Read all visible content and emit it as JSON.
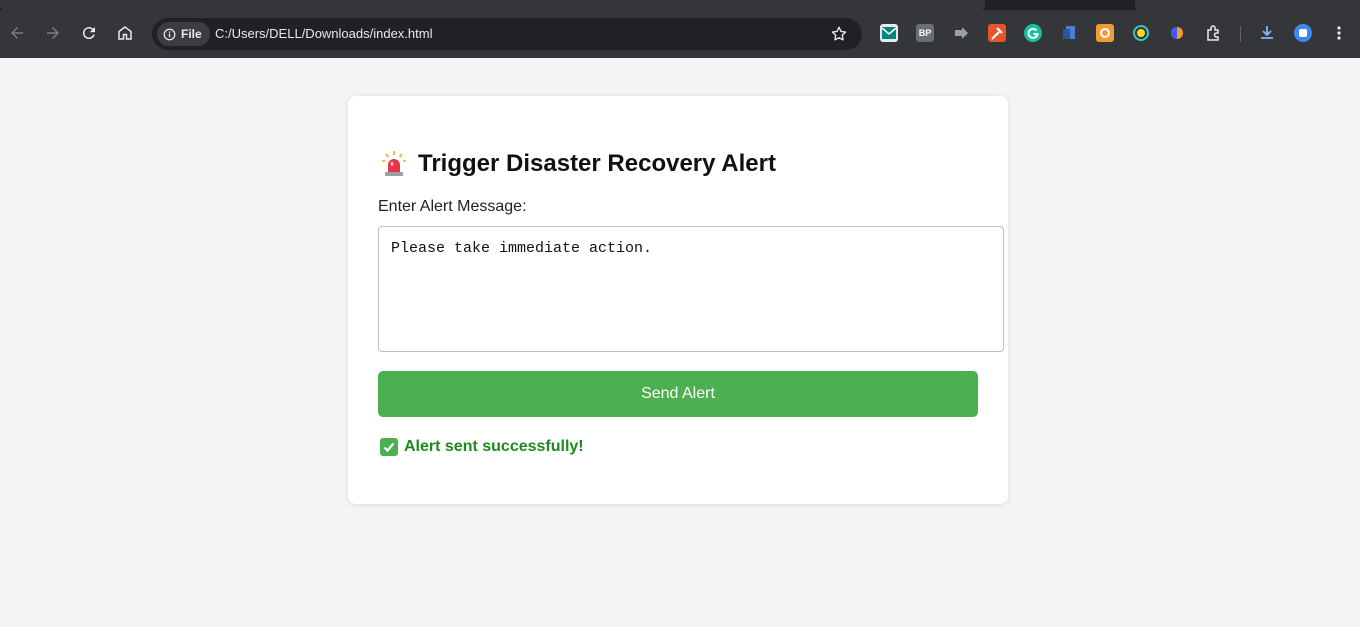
{
  "browser": {
    "site_chip": "File",
    "url": "C:/Users/DELL/Downloads/index.html",
    "extensions": [
      "mail-icon",
      "bp-icon",
      "puzzle-arrow-icon",
      "hammer-icon",
      "grammarly-icon",
      "document-icon",
      "orange-box-icon",
      "chat-icon",
      "half-moon-icon",
      "extensions-icon"
    ],
    "bp_label": "BP"
  },
  "page": {
    "title": "Trigger Disaster Recovery Alert",
    "message_label": "Enter Alert Message:",
    "message_value": "Please take immediate action.",
    "send_label": "Send Alert",
    "status_text": "Alert sent successfully!"
  },
  "colors": {
    "button": "#4caf50",
    "status": "#1e8a1e",
    "chrome": "#35363a"
  }
}
